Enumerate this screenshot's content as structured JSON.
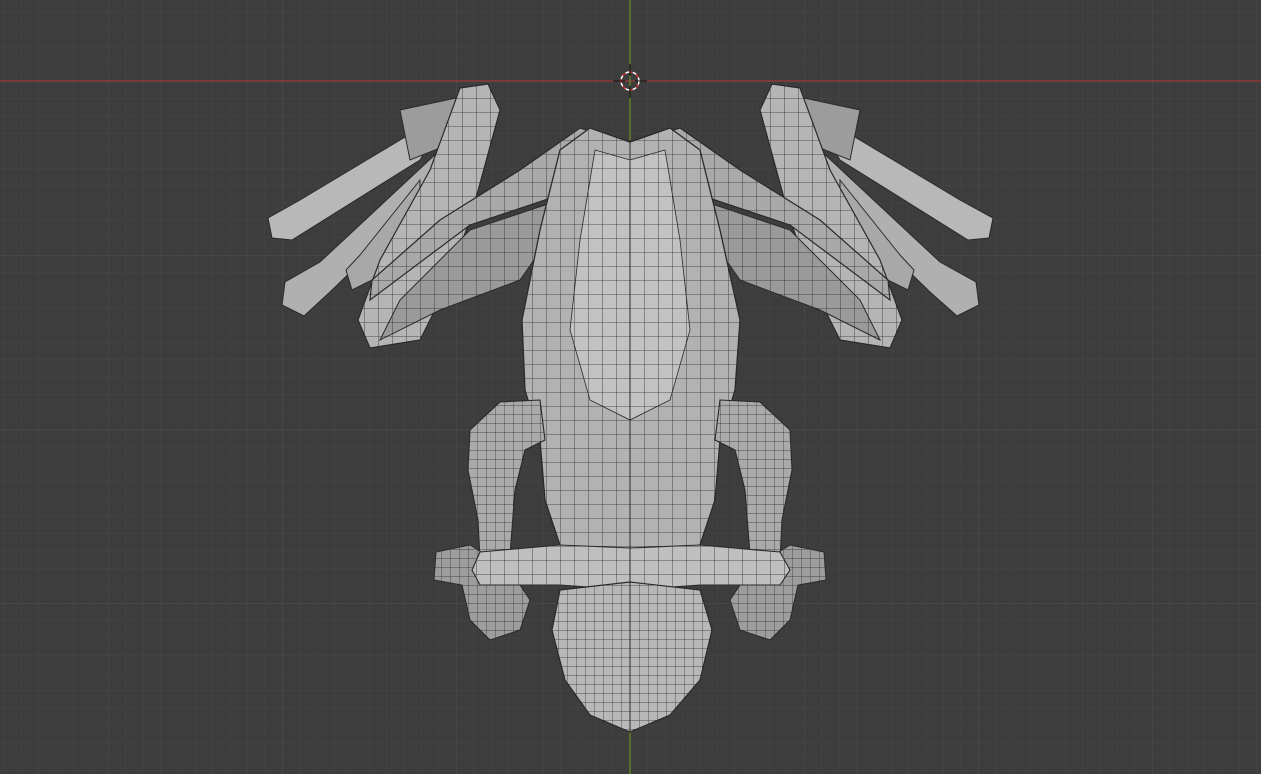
{
  "viewport": {
    "view": "3d-viewport",
    "shading": "solid-wireframe",
    "object": "low-poly-frog-mesh"
  },
  "colors": {
    "background": "#3d3d3d",
    "grid_minor": "#464646",
    "grid_major": "#4e4e4e",
    "axis_x": "#a03a3a",
    "axis_y": "#6b8e23",
    "mesh_light": "#bdbdbd",
    "mesh_mid": "#a4a4a4",
    "mesh_dark": "#7e7e7e",
    "wire": "#2a2a2a"
  },
  "icons": {
    "cursor": "3d-cursor-icon"
  }
}
